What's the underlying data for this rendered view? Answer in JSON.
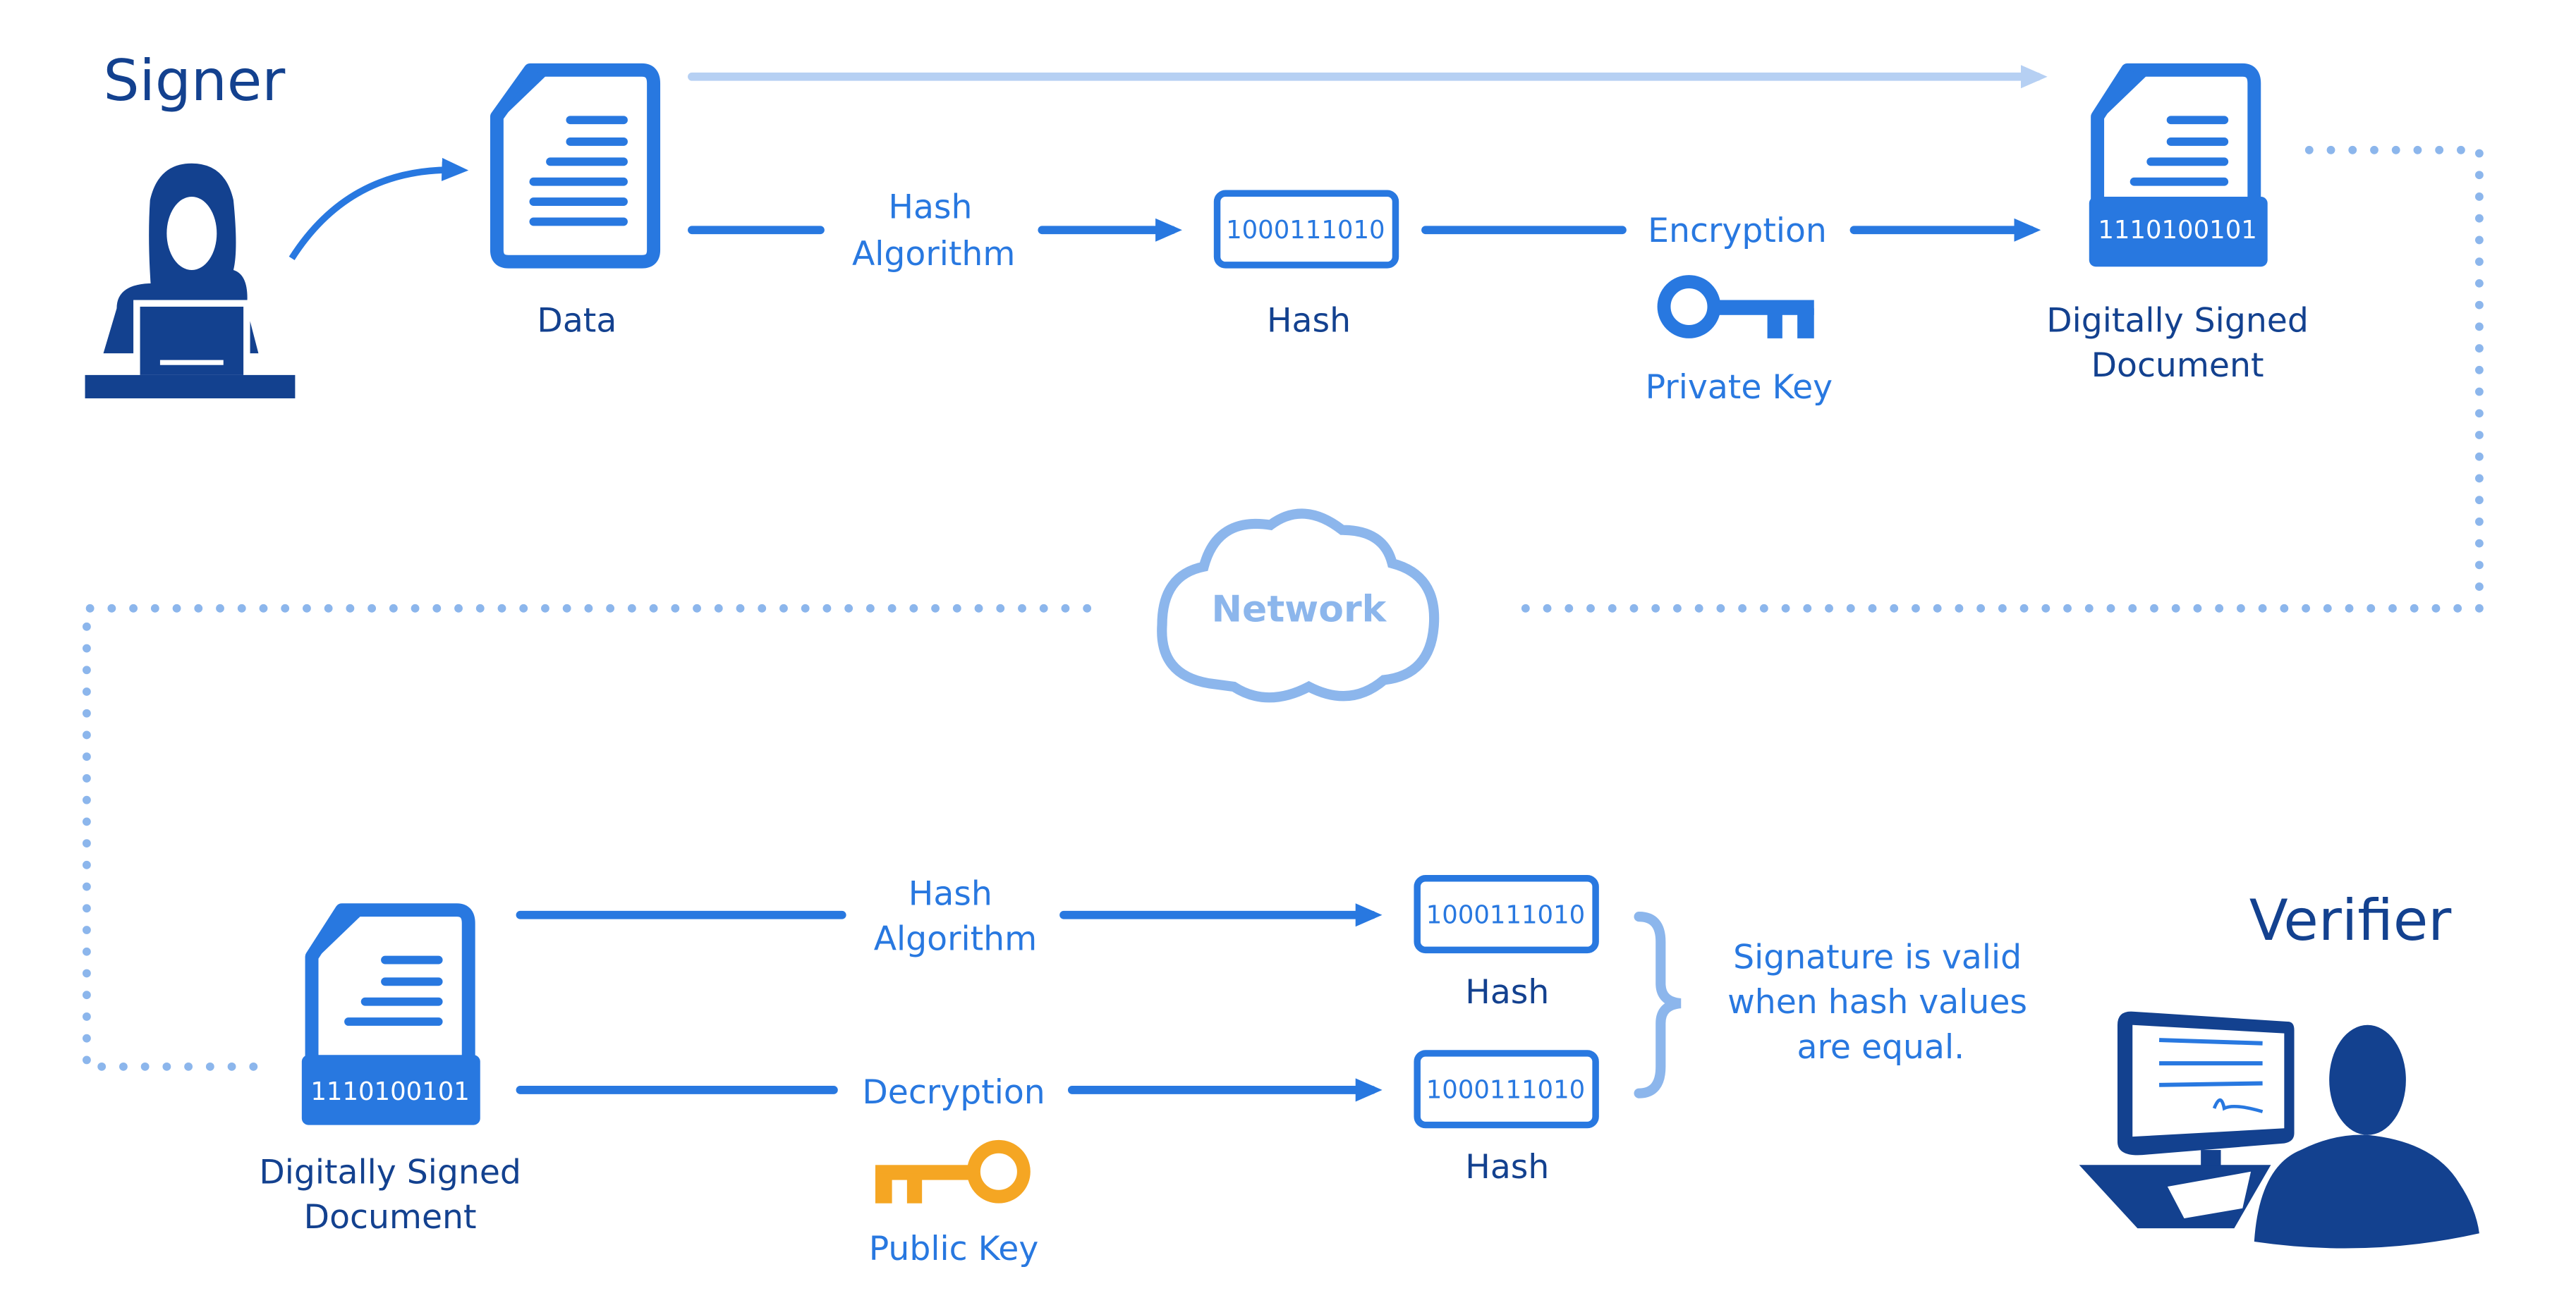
{
  "colors": {
    "navy": "#13418f",
    "blue": "#2878e0",
    "light_blue": "#8cb6ec",
    "orange": "#f5a623"
  },
  "signer": {
    "title": "Signer",
    "data_label": "Data",
    "hash_algorithm": [
      "Hash",
      "Algorithm"
    ],
    "hash_value": "1000111010",
    "hash_label": "Hash",
    "encryption_label": "Encryption",
    "private_key_label": "Private Key",
    "signed_value": "1110100101",
    "signed_label": [
      "Digitally Signed",
      "Document"
    ]
  },
  "network": {
    "label": "Network"
  },
  "verifier": {
    "title": "Verifier",
    "signed_value": "1110100101",
    "signed_label": [
      "Digitally Signed",
      "Document"
    ],
    "hash_algorithm": [
      "Hash",
      "Algorithm"
    ],
    "decryption_label": "Decryption",
    "public_key_label": "Public Key",
    "hash1_value": "1000111010",
    "hash1_label": "Hash",
    "hash2_value": "1000111010",
    "hash2_label": "Hash",
    "note": [
      "Signature is valid",
      "when hash values",
      "are equal."
    ]
  }
}
